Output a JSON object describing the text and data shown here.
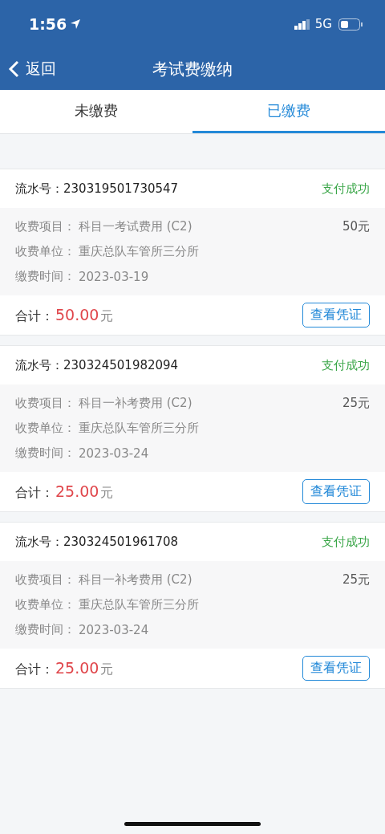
{
  "status_bar": {
    "time": "1:56",
    "network": "5G"
  },
  "nav_bar": {
    "back": "返回",
    "title": "考试费缴纳"
  },
  "tabs": [
    {
      "label": "未缴费",
      "selected": false
    },
    {
      "label": "已缴费",
      "selected": true
    }
  ],
  "records": [
    {
      "serial_label": "流水号：",
      "serial": "230319501730547",
      "status": "支付成功",
      "item_label": "收费项目：",
      "item": "科目一考试费用 (C2)",
      "amount": "50元",
      "unit_label": "收费单位：",
      "unit": "重庆总队车管所三分所",
      "time_label": "缴费时间：",
      "time": "2023-03-19",
      "total_label": "合计：",
      "total": "50.00",
      "currency": "元",
      "button": "查看凭证"
    },
    {
      "serial_label": "流水号：",
      "serial": "230324501982094",
      "status": "支付成功",
      "item_label": "收费项目：",
      "item": "科目一补考费用 (C2)",
      "amount": "25元",
      "unit_label": "收费单位：",
      "unit": "重庆总队车管所三分所",
      "time_label": "缴费时间：",
      "time": "2023-03-24",
      "total_label": "合计：",
      "total": "25.00",
      "currency": "元",
      "button": "查看凭证"
    },
    {
      "serial_label": "流水号：",
      "serial": "230324501961708",
      "status": "支付成功",
      "item_label": "收费项目：",
      "item": "科目一补考费用 (C2)",
      "amount": "25元",
      "unit_label": "收费单位：",
      "unit": "重庆总队车管所三分所",
      "time_label": "缴费时间：",
      "time": "2023-03-24",
      "total_label": "合计：",
      "total": "25.00",
      "currency": "元",
      "button": "查看凭证"
    }
  ]
}
